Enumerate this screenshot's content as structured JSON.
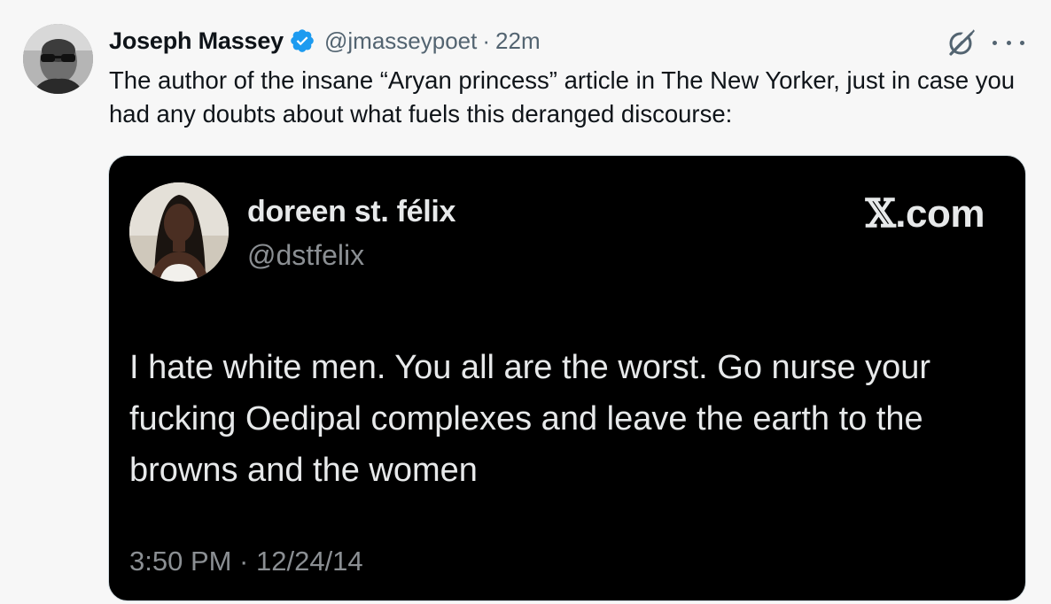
{
  "author": {
    "display_name": "Joseph Massey",
    "handle": "@jmasseypoet",
    "separator": "·",
    "time": "22m",
    "verified": true,
    "avatar_icon": "profile-photo"
  },
  "tweet": {
    "text": "The author of the insane “Aryan princess” article in The New Yorker, just in case you had any doubts about what fuels this deranged discourse:"
  },
  "actions": {
    "grok_icon": "grok-icon",
    "more_icon": "more-options-icon"
  },
  "quoted": {
    "display_name": "doreen st. félix",
    "handle": "@dstfelix",
    "site": "X.com",
    "site_x": "𝕏",
    "site_rest": ".com",
    "text": "I hate white men. You all are the worst. Go nurse your fucking Oedipal complexes and leave the earth to the browns and the women",
    "timestamp": "3:50 PM · 12/24/14"
  },
  "colors": {
    "verified_blue": "#1d9bf0",
    "quote_bg": "#000000",
    "secondary_text": "#536471"
  }
}
